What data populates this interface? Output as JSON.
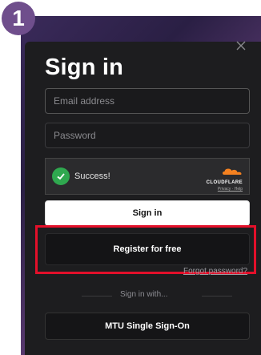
{
  "step_badge": "1",
  "form": {
    "title": "Sign in",
    "email_placeholder": "Email address",
    "password_placeholder": "Password"
  },
  "captcha": {
    "status": "Success!",
    "provider": "CLOUDFLARE",
    "links": "Privacy · Help"
  },
  "buttons": {
    "sign_in": "Sign in",
    "register": "Register for free",
    "sso": "MTU Single Sign-On"
  },
  "links": {
    "forgot_password": "Forgot password?",
    "sign_in_with": "Sign in with..."
  },
  "colors": {
    "highlight": "#e3102a",
    "badge": "#6f4e8c",
    "success": "#2fa84f",
    "cloudflare_orange": "#f48120"
  }
}
